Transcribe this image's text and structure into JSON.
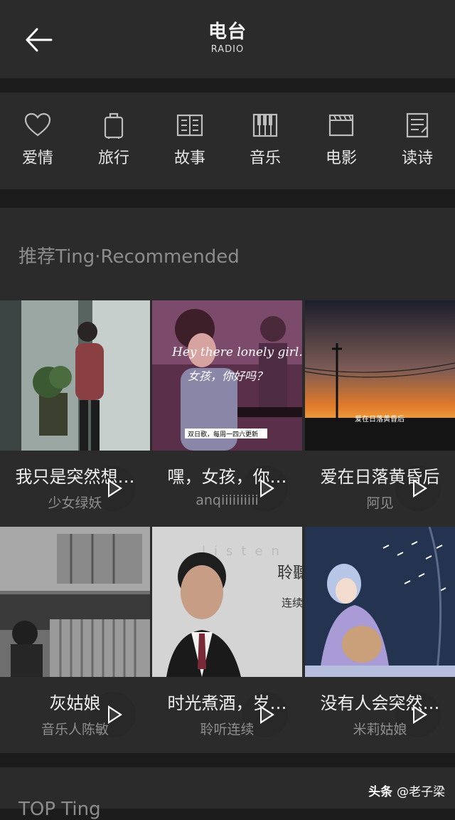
{
  "header": {
    "title": "电台",
    "subtitle": "RADIO"
  },
  "categories": [
    {
      "label": "爱情",
      "icon": "heart-icon"
    },
    {
      "label": "旅行",
      "icon": "luggage-icon"
    },
    {
      "label": "故事",
      "icon": "book-icon"
    },
    {
      "label": "音乐",
      "icon": "piano-icon"
    },
    {
      "label": "电影",
      "icon": "clapperboard-icon"
    },
    {
      "label": "读诗",
      "icon": "document-icon"
    }
  ],
  "recommended": {
    "title": "推荐Ting·Recommended",
    "items": [
      {
        "name": "我只是突然想…",
        "author": "少女绿妖"
      },
      {
        "name": "嘿，女孩，你…",
        "author": "anqiiiiiiiiii",
        "cover_text": [
          "Hey there lonely girl.",
          "女孩，你好吗？",
          "双日歌，每周一四六更新"
        ]
      },
      {
        "name": "爱在日落黄昏后",
        "author": "阿见",
        "cover_text": [
          "爱在日落黄昏后"
        ]
      },
      {
        "name": "灰姑娘",
        "author": "音乐人陈敏"
      },
      {
        "name": "时光煮酒，岁…",
        "author": "聆听连续",
        "cover_text": [
          "listen",
          "聆聽",
          "连续"
        ]
      },
      {
        "name": "没有人会突然…",
        "author": "米莉姑娘"
      }
    ]
  },
  "next_section": {
    "title": "TOP Ting"
  },
  "watermark": {
    "brand": "头条",
    "handle": "@老子梁"
  },
  "colors": {
    "background": "#1c1c1c",
    "panel": "#2b2b2b",
    "text": "#e8e8e8",
    "muted": "#8c8c8c"
  }
}
